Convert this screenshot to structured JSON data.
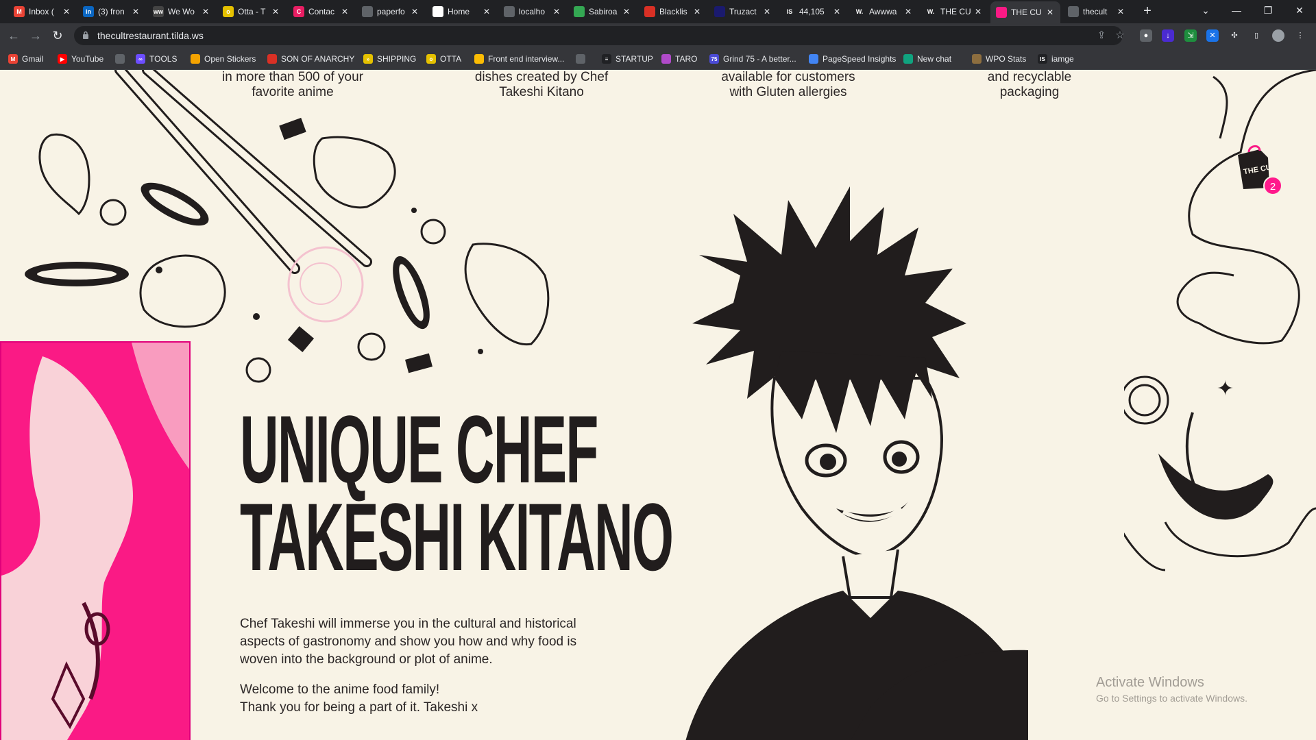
{
  "browser": {
    "tabs": [
      {
        "title": "Inbox (",
        "icon": "gmail-icon",
        "color": "#ea4335",
        "letter": "M"
      },
      {
        "title": "(3) fron",
        "icon": "linkedin-icon",
        "color": "#0a66c2",
        "letter": "in"
      },
      {
        "title": "We Wo",
        "icon": "wwr-icon",
        "color": "#444444",
        "letter": "ww"
      },
      {
        "title": "Otta - T",
        "icon": "otta-icon",
        "color": "#e5c100",
        "letter": "o"
      },
      {
        "title": "Contac",
        "icon": "contact-icon",
        "color": "#e91e63",
        "letter": "C"
      },
      {
        "title": "paperfo",
        "icon": "globe-icon",
        "color": "#5f6368",
        "letter": ""
      },
      {
        "title": "Home",
        "icon": "home-icon",
        "color": "#ffffff",
        "letter": ""
      },
      {
        "title": "localho",
        "icon": "globe-icon",
        "color": "#5f6368",
        "letter": ""
      },
      {
        "title": "Sabiroa",
        "icon": "map-pin-icon",
        "color": "#34a853",
        "letter": ""
      },
      {
        "title": "Blacklis",
        "icon": "blacklist-icon",
        "color": "#d93025",
        "letter": ""
      },
      {
        "title": "Truzact",
        "icon": "truzact-icon",
        "color": "#1a1a6e",
        "letter": ""
      },
      {
        "title": "44,105",
        "icon": "is-icon",
        "color": "#202124",
        "letter": "IS"
      },
      {
        "title": "Awwwa",
        "icon": "awwwards-icon",
        "color": "#202124",
        "letter": "W."
      },
      {
        "title": "THE CU",
        "icon": "awwwards-icon",
        "color": "#202124",
        "letter": "W."
      },
      {
        "title": "THE CU",
        "icon": "cult-icon",
        "color": "#fa1a85",
        "letter": ""
      },
      {
        "title": "thecult",
        "icon": "globe-icon",
        "color": "#5f6368",
        "letter": ""
      }
    ],
    "url": "thecultrestaurant.tilda.ws",
    "bookmarks": [
      {
        "label": "Gmail",
        "color": "#ea4335",
        "letter": "M"
      },
      {
        "label": "YouTube",
        "color": "#ff0000",
        "letter": "▶"
      },
      {
        "label": "",
        "color": "#5f6368",
        "letter": ""
      },
      {
        "label": "TOOLS",
        "color": "#6c4dff",
        "letter": "∞"
      },
      {
        "label": "Open Stickers",
        "color": "#f4a300",
        "letter": ""
      },
      {
        "label": "SON OF ANARCHY",
        "color": "#d93025",
        "letter": ""
      },
      {
        "label": "SHIPPING",
        "color": "#e5c100",
        "letter": "»"
      },
      {
        "label": "OTTA",
        "color": "#e5c100",
        "letter": "o"
      },
      {
        "label": "Front end interview...",
        "color": "#fbbc04",
        "letter": ""
      },
      {
        "label": "",
        "color": "#5f6368",
        "letter": ""
      },
      {
        "label": "STARTUP",
        "color": "#202124",
        "letter": "≡"
      },
      {
        "label": "TARO",
        "color": "#b04ac9",
        "letter": ""
      },
      {
        "label": "Grind 75 - A better...",
        "color": "#4b4bd6",
        "letter": "75"
      },
      {
        "label": "PageSpeed Insights",
        "color": "#4285f4",
        "letter": ""
      },
      {
        "label": "New chat",
        "color": "#10a37f",
        "letter": ""
      },
      {
        "label": "WPO Stats",
        "color": "#8d6e3f",
        "letter": ""
      },
      {
        "label": "iamge",
        "color": "#202124",
        "letter": "IS"
      }
    ]
  },
  "features": [
    {
      "line1": "in more than 500 of your",
      "line2": "favorite anime"
    },
    {
      "line1": "dishes created by Chef",
      "line2": "Takeshi Kitano"
    },
    {
      "line1": "available for customers",
      "line2": "with Gluten allergies"
    },
    {
      "line1": "and recyclable",
      "line2": "packaging"
    }
  ],
  "hero": {
    "title_line1": "UNIQUE CHEF",
    "title_line2": "TAKESHI KITANO",
    "paragraph": "Chef Takeshi will immerse you in the cultural and historical aspects of gastronomy and show you how and why food is woven into the background or plot of anime.",
    "welcome": "Welcome to the anime food family!",
    "thanks": "Thank you for being a part of it. Takeshi x"
  },
  "cart": {
    "count": "2",
    "brand": "THE CULT"
  },
  "os_watermark": {
    "title": "Activate Windows",
    "subtitle": "Go to Settings to activate Windows."
  },
  "colors": {
    "accent": "#fa1a85",
    "background": "#f8f3e6",
    "ink": "#211d1d"
  }
}
